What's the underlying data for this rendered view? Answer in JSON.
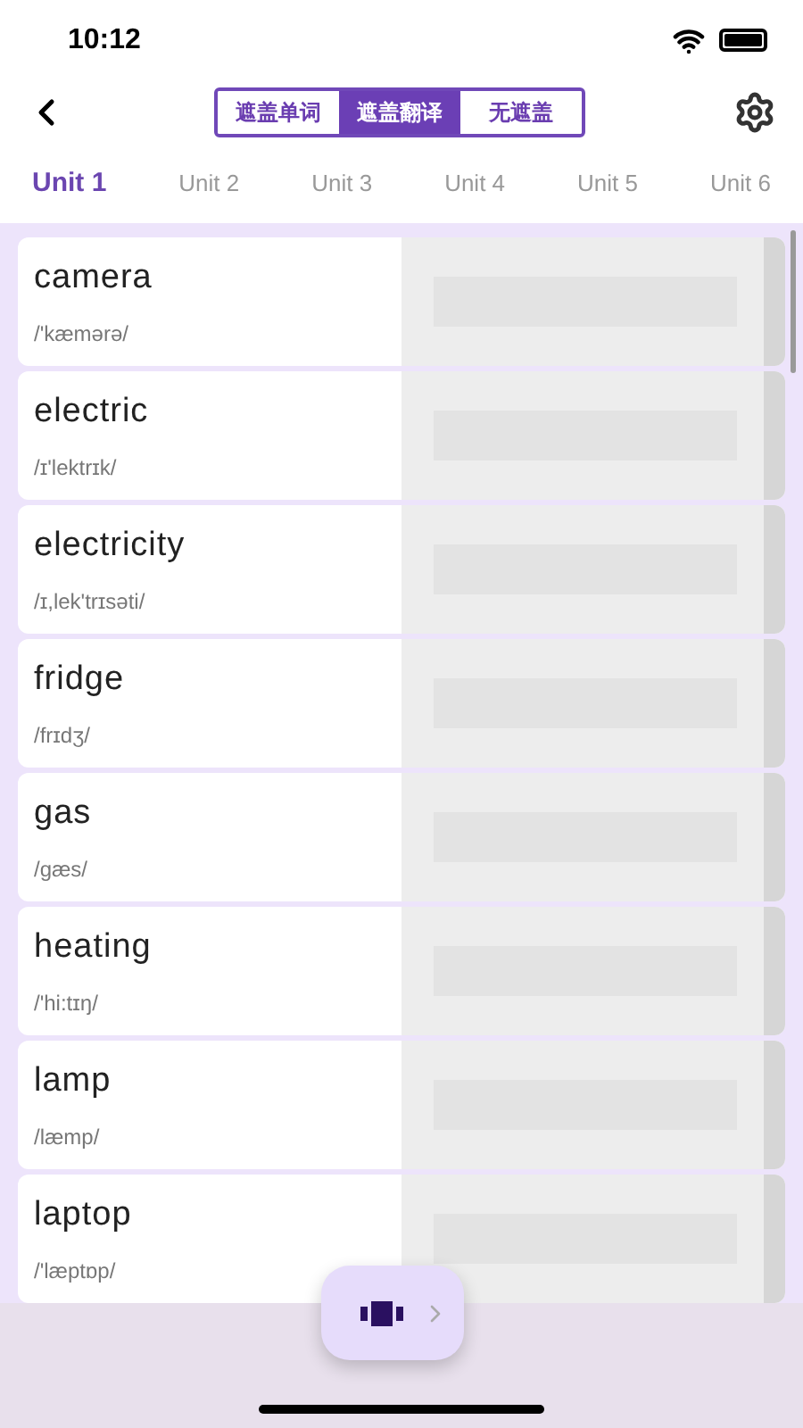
{
  "status_bar": {
    "time": "10:12"
  },
  "mode_tabs": [
    {
      "label": "遮盖单词",
      "selected": false
    },
    {
      "label": "遮盖翻译",
      "selected": true
    },
    {
      "label": "无遮盖",
      "selected": false
    }
  ],
  "unit_tabs": [
    {
      "label": "Unit 1",
      "selected": true
    },
    {
      "label": "Unit 2",
      "selected": false
    },
    {
      "label": "Unit 3",
      "selected": false
    },
    {
      "label": "Unit 4",
      "selected": false
    },
    {
      "label": "Unit 5",
      "selected": false
    },
    {
      "label": "Unit 6",
      "selected": false
    }
  ],
  "words": [
    {
      "word": "camera",
      "phonetic": "/'kæmərə/"
    },
    {
      "word": "electric",
      "phonetic": "/ɪ'lektrɪk/"
    },
    {
      "word": "electricity",
      "phonetic": "/ɪ,lek'trɪsəti/"
    },
    {
      "word": "fridge",
      "phonetic": "/frɪdʒ/"
    },
    {
      "word": "gas",
      "phonetic": "/gæs/"
    },
    {
      "word": "heating",
      "phonetic": "/'hi:tɪŋ/"
    },
    {
      "word": "lamp",
      "phonetic": "/læmp/"
    },
    {
      "word": "laptop",
      "phonetic": "/'læptɒp/"
    }
  ]
}
